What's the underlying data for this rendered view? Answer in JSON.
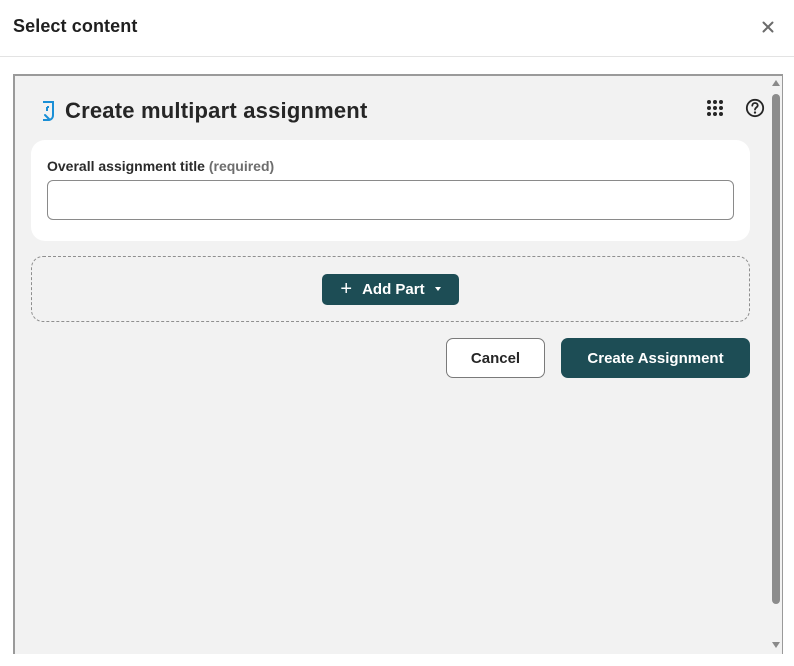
{
  "dialog": {
    "title": "Select content",
    "close_icon": "close-icon"
  },
  "page": {
    "title": "Create multipart assignment",
    "title_icon": "multipart-assignment-icon",
    "tools": {
      "apps_icon": "apps-grid-icon",
      "help_icon": "help-icon"
    }
  },
  "form": {
    "title_label": "Overall assignment title",
    "title_required": "(required)",
    "title_value": "",
    "title_placeholder": ""
  },
  "parts": {
    "add_part_label": "Add Part",
    "plus_glyph": "+"
  },
  "actions": {
    "cancel_label": "Cancel",
    "create_label": "Create Assignment"
  },
  "colors": {
    "primary": "#1d4d55",
    "accent_icon": "#1a8fd6",
    "frame_bg": "#f2f2f2"
  }
}
